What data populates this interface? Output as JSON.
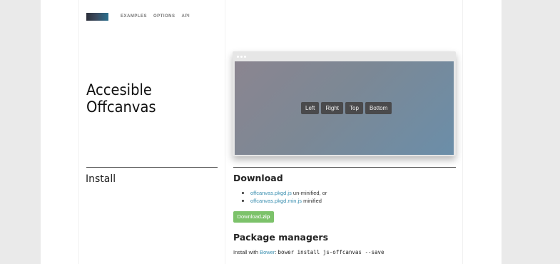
{
  "nav": {
    "items": [
      "EXAMPLES",
      "OPTIONS",
      "API"
    ]
  },
  "hero": {
    "title_line1": "Accesible",
    "title_line2": "Offcanvas"
  },
  "demo": {
    "buttons": [
      "Left",
      "Right",
      "Top",
      "Bottom"
    ]
  },
  "install": {
    "heading": "Install"
  },
  "download": {
    "heading": "Download",
    "files": [
      {
        "link": "offcanvas.pkgd.js",
        "note": " un-minified, or"
      },
      {
        "link": "offcanvas.pkgd.min.js",
        "note": " minified"
      }
    ],
    "button_prefix": "Download",
    "button_suffix": ".zip"
  },
  "package_managers": {
    "heading": "Package managers",
    "bower_prefix": "Install with ",
    "bower_link": "Bower",
    "bower_sep": ": ",
    "bower_command": "bower install js-offcanvas --save"
  },
  "colors": {
    "background": "#eaeaea",
    "link": "#3a8fb0",
    "download_button": "#7cc26a",
    "demo_button": "#4a4a4c"
  }
}
